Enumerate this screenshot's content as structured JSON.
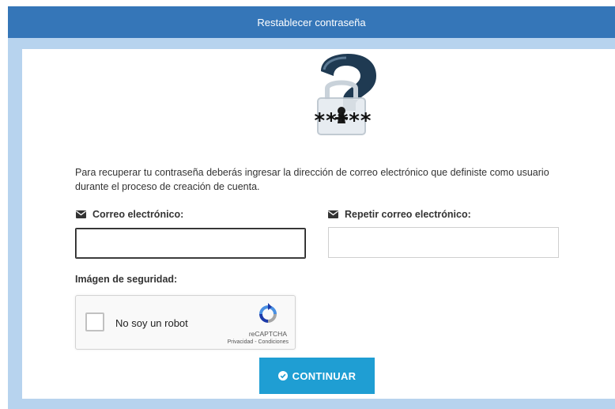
{
  "header": {
    "title": "Restablecer contraseña"
  },
  "logo": {
    "icon": "password-question-lock-icon",
    "text": "*****"
  },
  "intro": {
    "text": "Para recuperar tu contraseña deberás ingresar la dirección de correo electrónico que definiste como usuario durante el proceso de creación de cuenta."
  },
  "form": {
    "email": {
      "label": "Correo electrónico:",
      "icon": "envelope-icon",
      "value": "",
      "placeholder": ""
    },
    "repeat_email": {
      "label": "Repetir correo electrónico:",
      "icon": "envelope-icon",
      "value": "",
      "placeholder": ""
    },
    "captcha": {
      "label": "Imágen de seguridad:",
      "checkbox_label": "No soy un robot",
      "brand": "reCAPTCHA",
      "links": "Privacidad - Condiciones"
    },
    "submit": {
      "label": "CONTINUAR",
      "icon": "check-circle-icon"
    }
  },
  "colors": {
    "header_bg": "#3576b8",
    "panel_border": "#b7d3ee",
    "button_bg": "#1f9ed3"
  }
}
